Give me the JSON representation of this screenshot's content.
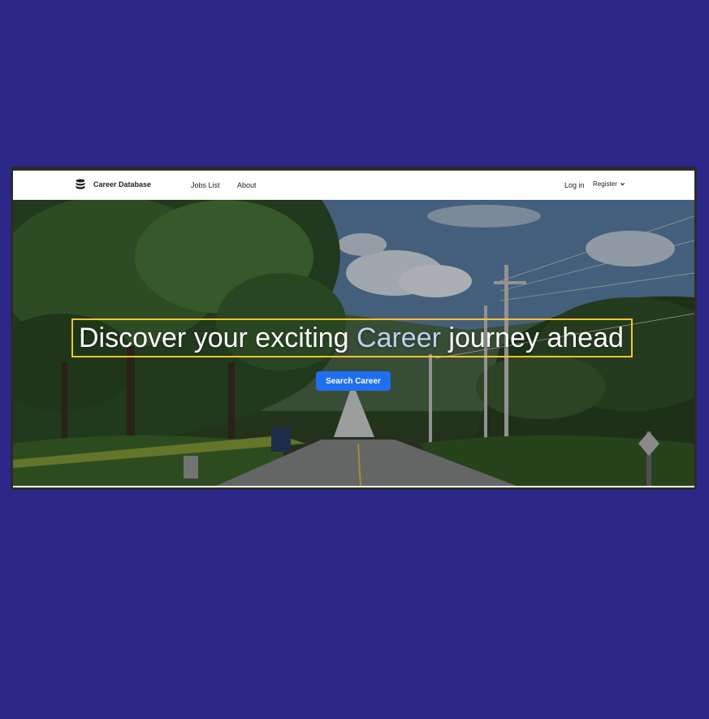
{
  "nav": {
    "brand_name": "Career Database",
    "brand_icon": "database-icon",
    "links": {
      "jobs": "Jobs List",
      "about": "About"
    },
    "login": "Log in",
    "register": "Register",
    "register_icon": "chevron-down-icon"
  },
  "hero": {
    "headline_start": "Discover your exciting ",
    "headline_accent": "Career",
    "headline_end": " journey ahead",
    "button_label": "Search Career",
    "background_image": "tree-lined-road-photo"
  },
  "colors": {
    "page_background": "#2c2889",
    "button": "#1f6ff0",
    "highlight_border": "#f4c430",
    "accent_text": "#b9d3f2"
  }
}
